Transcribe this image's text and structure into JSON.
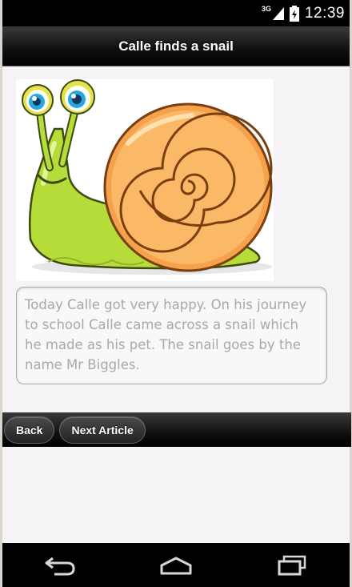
{
  "status_bar": {
    "network": "3G",
    "time": "12:39",
    "icons": [
      "signal-icon",
      "battery-icon"
    ]
  },
  "header": {
    "title": "Calle finds a snail"
  },
  "article": {
    "image": "snail-illustration",
    "text": "Today Calle got very happy. On his journey to school Calle came across a snail which he made as his pet. The snail goes by the name Mr Biggles."
  },
  "footer": {
    "back_label": "Back",
    "next_label": "Next Article"
  },
  "nav_bar": {
    "icons": [
      "back-arrow-icon",
      "home-icon",
      "recent-apps-icon"
    ]
  },
  "colors": {
    "header_bg": "#000000",
    "shell": "#0d9ed8",
    "body_green": "#b6dc3a",
    "eye_blue": "#2aa6de"
  }
}
